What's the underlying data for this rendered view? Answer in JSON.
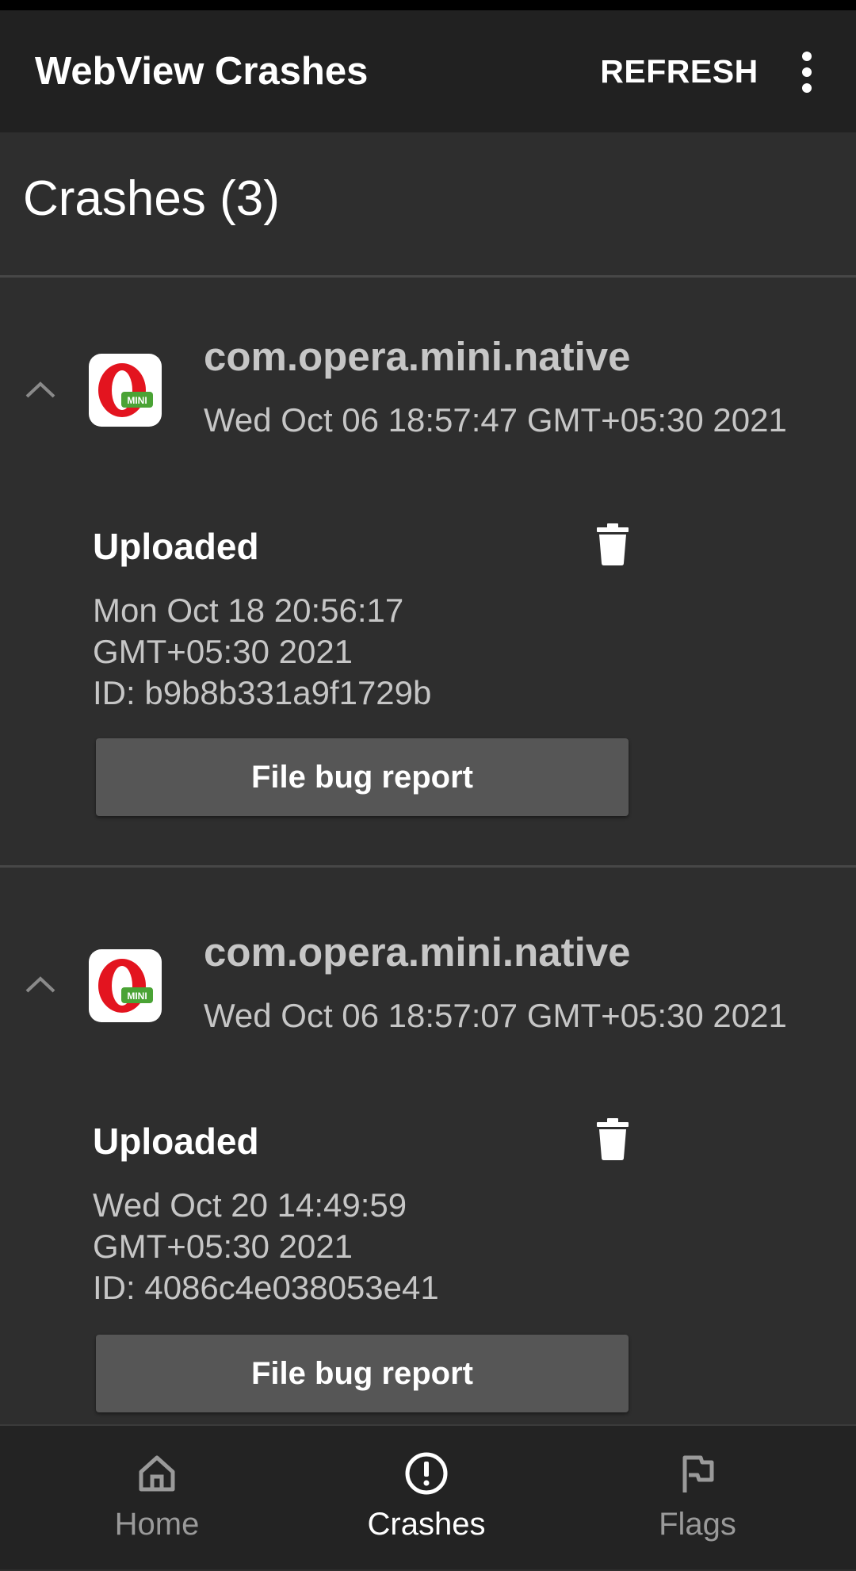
{
  "app_bar": {
    "title": "WebView Crashes",
    "refresh_label": "REFRESH",
    "overflow_icon": "more-vert-icon"
  },
  "section": {
    "title": "Crashes (3)"
  },
  "crashes": [
    {
      "package": "com.opera.mini.native",
      "crash_time": "Wed Oct 06 18:57:47 GMT+05:30 2021",
      "status": "Uploaded",
      "upload_time_line1": "Mon Oct 18 20:56:17",
      "upload_time_line2": "GMT+05:30 2021",
      "id_line": "ID: b9b8b331a9f1729b",
      "button_label": "File bug report"
    },
    {
      "package": "com.opera.mini.native",
      "crash_time": "Wed Oct 06 18:57:07 GMT+05:30 2021",
      "status": "Uploaded",
      "upload_time_line1": "Wed Oct 20 14:49:59",
      "upload_time_line2": "GMT+05:30 2021",
      "id_line": "ID: 4086c4e038053e41",
      "button_label": "File bug report"
    }
  ],
  "app_icon": {
    "badge_text": "MINI",
    "icon": "opera-mini-icon"
  },
  "bottom_nav": {
    "items": [
      {
        "label": "Home",
        "icon": "home-icon",
        "active": false
      },
      {
        "label": "Crashes",
        "icon": "alert-circle-icon",
        "active": true
      },
      {
        "label": "Flags",
        "icon": "flag-icon",
        "active": false
      }
    ]
  },
  "colors": {
    "background": "#2e2e2e",
    "app_bar": "#212121",
    "button": "#565656",
    "secondary_text": "#c6c6c6",
    "opera_red": "#e3141f",
    "mini_green": "#4aa335"
  }
}
